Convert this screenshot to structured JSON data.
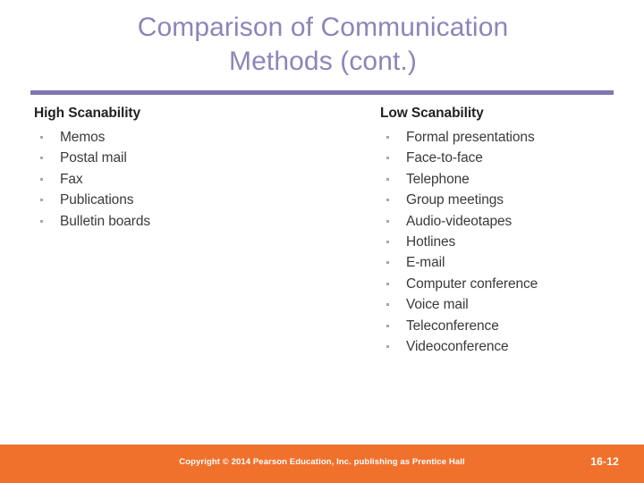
{
  "slide": {
    "title_lines": [
      "Comparison of Communication",
      "Methods (cont.)"
    ],
    "title_color": "#8b86b8",
    "rule_color": "#7f77b0",
    "background_color": "#ffffff"
  },
  "columns": {
    "left": {
      "heading": "High Scanability",
      "items": [
        "Memos",
        "Postal mail",
        "Fax",
        "Publications",
        "Bulletin boards"
      ]
    },
    "right": {
      "heading": "Low Scanability",
      "items": [
        "Formal presentations",
        "Face-to-face",
        "Telephone",
        "Group meetings",
        "Audio-videotapes",
        "Hotlines",
        "E-mail",
        "Computer conference",
        "Voice mail",
        "Teleconference",
        "Videoconference"
      ]
    }
  },
  "footer": {
    "copyright": "Copyright © 2014 Pearson Education, Inc. publishing as Prentice Hall",
    "page_number": "16-12",
    "background_color": "#f0712c",
    "text_color": "#ffffff"
  }
}
